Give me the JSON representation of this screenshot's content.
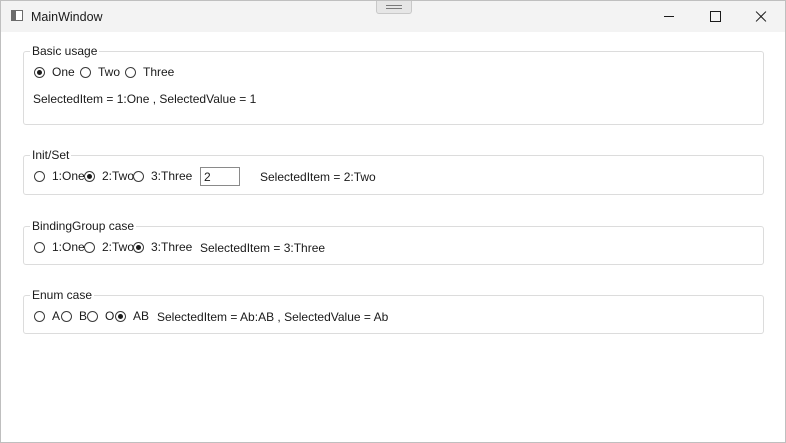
{
  "window": {
    "title": "MainWindow"
  },
  "groups": {
    "basic": {
      "legend": "Basic usage",
      "options": [
        "One",
        "Two",
        "Three"
      ],
      "selected_index": 0,
      "status": "SelectedItem = 1:One , SelectedValue = 1"
    },
    "init": {
      "legend": "Init/Set",
      "options": [
        "1:One",
        "2:Two",
        "3:Three"
      ],
      "selected_index": 1,
      "textbox_value": "2",
      "status": "SelectedItem = 2:Two"
    },
    "bindinggroup": {
      "legend": "BindingGroup case",
      "options": [
        "1:One",
        "2:Two",
        "3:Three"
      ],
      "selected_index": 2,
      "status": "SelectedItem = 3:Three"
    },
    "enum": {
      "legend": "Enum case",
      "options": [
        "A",
        "B",
        "O",
        "AB"
      ],
      "selected_index": 3,
      "status": "SelectedItem = Ab:AB , SelectedValue = Ab"
    }
  }
}
